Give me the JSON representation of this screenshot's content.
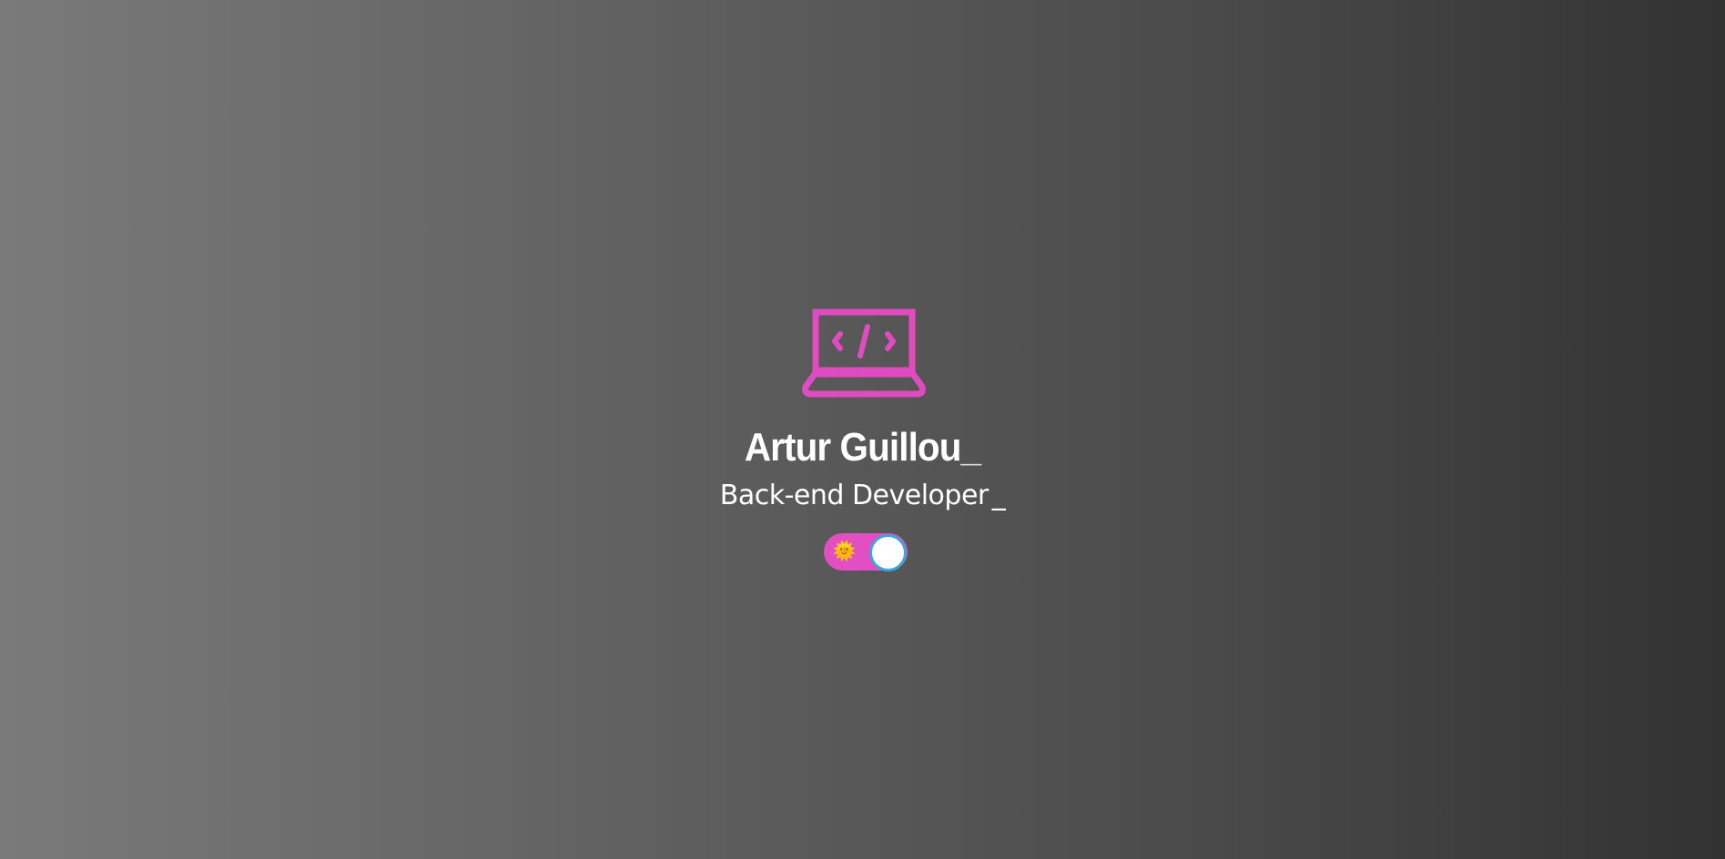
{
  "profile": {
    "name": "Artur Guillou",
    "name_cursor": "_",
    "role": "Back-end Developer",
    "role_cursor": "_"
  },
  "icons": {
    "logo": "laptop-code-icon",
    "theme_indicator": "sun-icon"
  },
  "theme_toggle": {
    "symbol": "🌞",
    "state": "on"
  },
  "colors": {
    "accent": "#e04cc0",
    "toggle_track": "#e24fc2",
    "toggle_knob_border": "#3ba6d9",
    "text": "#ffffff",
    "background_left": "#7a7a7a",
    "background_right": "#323232"
  }
}
